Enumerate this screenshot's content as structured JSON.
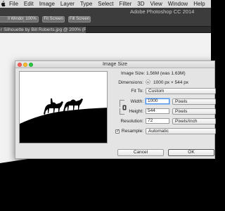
{
  "menubar": {
    "items": [
      "File",
      "Edit",
      "Image",
      "Layer",
      "Type",
      "Select",
      "Filter",
      "3D",
      "View",
      "Window",
      "Help"
    ]
  },
  "app_title": "Adobe Photoshop CC 2014",
  "options_bar": {
    "buttons": [
      "ll Windows",
      "100%",
      "Fit Screen",
      "Fill Screen"
    ]
  },
  "document_tab": {
    "label": "r Silhouette by Bill Roberts.jpg @ 200% (RGB/8#)"
  },
  "dialog": {
    "title": "Image Size",
    "image_size_label": "Image Size:",
    "image_size_value": "1.56M (was 1.63M)",
    "dimensions_label": "Dimensions:",
    "dimensions_value": "1000 px × 544 px",
    "fit_to_label": "Fit To:",
    "fit_to_value": "Custom",
    "width_label": "Width:",
    "width_value": "1000",
    "width_unit": "Pixels",
    "height_label": "Height:",
    "height_value": "544",
    "height_unit": "Pixels",
    "resolution_label": "Resolution:",
    "resolution_value": "72",
    "resolution_unit": "Pixels/Inch",
    "resample_label": "Resample:",
    "resample_checked": "✓",
    "resample_value": "Automatic",
    "cancel_label": "Cancel",
    "ok_label": "OK"
  },
  "colors": {
    "close": "#fc5f57",
    "minimize": "#fdbc2e",
    "zoom": "#29c941",
    "focus": "#4a8fe0"
  }
}
